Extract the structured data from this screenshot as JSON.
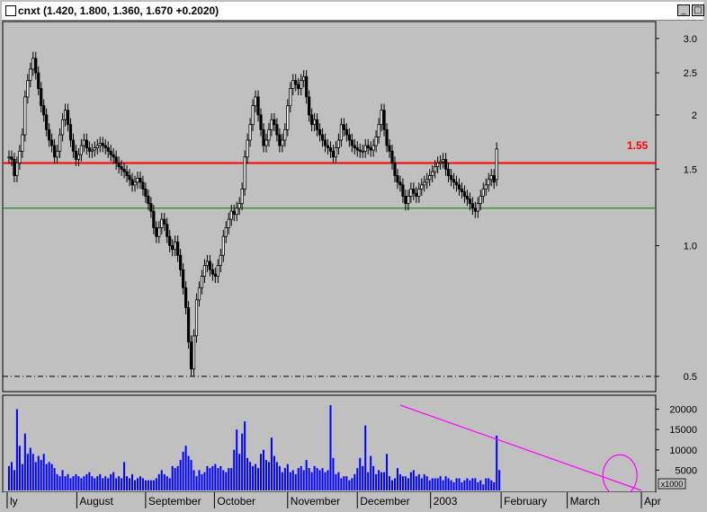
{
  "window": {
    "title": "cnxt  (1.420, 1.800, 1.360, 1.670 +0.2020)",
    "minimize_glyph": "_",
    "maximize_glyph": "□"
  },
  "colors": {
    "panel": "#c0c0c0",
    "candle": "#000000",
    "resistance": "#ff0000",
    "support": "#008000",
    "volume": "#0000ff",
    "trend": "#ff00ff",
    "annotation": "#ff0000"
  },
  "chart_data": [
    {
      "type": "line",
      "subtype": "candlestick",
      "scale": "log",
      "ylim": [
        0.47,
        3.25
      ],
      "yticks": [
        {
          "value": 3.0,
          "label": "3.0"
        },
        {
          "value": 2.5,
          "label": "2.5"
        },
        {
          "value": 2.0,
          "label": "2"
        },
        {
          "value": 1.5,
          "label": "1.5"
        },
        {
          "value": 1.0,
          "label": "1.0"
        },
        {
          "value": 0.5,
          "label": "0.5"
        }
      ],
      "series": [
        {
          "x": [
            0,
            3,
            6,
            9,
            12,
            15,
            18,
            21,
            24,
            27,
            30,
            33,
            36,
            39,
            42,
            45,
            48,
            51,
            54,
            57,
            60,
            63,
            66,
            69,
            72,
            75,
            78,
            81,
            84,
            87,
            90,
            93,
            96,
            99,
            102,
            105,
            108,
            111,
            114,
            117,
            120,
            123,
            126,
            129,
            132,
            135,
            138,
            141,
            144,
            147,
            150,
            153,
            156,
            159,
            162,
            165,
            168,
            171,
            174,
            177,
            180,
            183,
            186,
            189,
            192,
            195,
            198,
            201,
            204,
            207,
            210,
            213,
            216,
            219,
            222,
            225,
            228,
            231,
            234,
            237,
            240,
            243,
            246,
            249,
            252,
            255,
            258,
            261,
            264,
            267,
            270,
            273,
            276,
            279,
            282,
            285,
            288,
            291,
            294,
            297,
            300,
            303,
            306,
            309,
            312,
            315,
            318,
            321,
            324,
            327,
            330,
            333,
            336,
            339,
            342,
            345,
            348,
            351,
            354,
            357,
            360,
            363,
            366,
            369,
            372,
            375,
            378,
            381,
            384,
            387,
            390,
            393,
            396,
            399,
            402,
            405,
            408,
            411,
            414,
            417,
            420,
            423,
            426,
            429,
            432,
            435,
            438,
            441,
            444,
            447,
            450,
            453,
            456,
            459,
            462,
            465,
            468,
            471,
            474,
            477,
            480,
            483,
            486,
            489,
            492,
            495,
            498,
            501,
            504,
            507,
            510,
            513,
            516,
            519,
            522,
            525,
            528,
            531,
            534,
            537,
            540,
            543,
            546,
            549,
            552,
            555,
            558,
            561,
            564,
            567,
            570,
            573,
            576,
            579,
            582,
            585,
            588,
            591,
            594,
            597,
            600,
            603,
            606,
            609,
            612,
            615,
            618,
            621,
            624,
            627,
            630,
            633,
            636,
            639,
            642,
            645,
            648,
            651,
            654,
            657,
            660,
            663,
            666,
            669,
            672,
            675,
            678,
            681,
            684
          ],
          "close": [
            1.6,
            1.58,
            1.45,
            1.55,
            1.65,
            1.8,
            2.2,
            2.4,
            2.55,
            2.7,
            2.5,
            2.3,
            2.1,
            2.0,
            1.85,
            1.75,
            1.7,
            1.6,
            1.65,
            1.8,
            1.95,
            2.05,
            1.9,
            1.75,
            1.65,
            1.58,
            1.62,
            1.7,
            1.75,
            1.68,
            1.65,
            1.66,
            1.68,
            1.7,
            1.72,
            1.7,
            1.68,
            1.65,
            1.62,
            1.6,
            1.55,
            1.52,
            1.5,
            1.48,
            1.45,
            1.42,
            1.38,
            1.4,
            1.43,
            1.4,
            1.35,
            1.3,
            1.25,
            1.2,
            1.1,
            1.05,
            1.1,
            1.15,
            1.12,
            1.05,
            1.0,
            0.98,
            1.02,
            0.95,
            0.88,
            0.8,
            0.72,
            0.6,
            0.52,
            0.62,
            0.75,
            0.8,
            0.85,
            0.9,
            0.92,
            0.88,
            0.86,
            0.85,
            0.9,
            0.95,
            1.05,
            1.1,
            1.15,
            1.2,
            1.18,
            1.22,
            1.25,
            1.35,
            1.6,
            1.75,
            1.9,
            2.1,
            2.2,
            2.0,
            1.85,
            1.7,
            1.75,
            1.85,
            1.95,
            1.9,
            1.8,
            1.7,
            1.75,
            1.85,
            2.1,
            2.3,
            2.4,
            2.35,
            2.3,
            2.4,
            2.45,
            2.2,
            2.0,
            1.9,
            1.95,
            1.85,
            1.8,
            1.75,
            1.7,
            1.68,
            1.65,
            1.6,
            1.68,
            1.75,
            1.9,
            1.85,
            1.8,
            1.75,
            1.7,
            1.68,
            1.66,
            1.65,
            1.65,
            1.7,
            1.68,
            1.66,
            1.7,
            1.78,
            1.9,
            2.05,
            1.85,
            1.7,
            1.65,
            1.55,
            1.45,
            1.4,
            1.38,
            1.3,
            1.25,
            1.3,
            1.35,
            1.32,
            1.3,
            1.35,
            1.38,
            1.4,
            1.42,
            1.45,
            1.48,
            1.52,
            1.55,
            1.56,
            1.58,
            1.5,
            1.45,
            1.42,
            1.4,
            1.38,
            1.35,
            1.33,
            1.3,
            1.28,
            1.25,
            1.22,
            1.2,
            1.25,
            1.3,
            1.35,
            1.38,
            1.42,
            1.45,
            1.4,
            1.67
          ],
          "open": [
            1.6,
            1.6,
            1.58,
            1.45,
            1.55,
            1.65,
            1.8,
            2.2,
            2.4,
            2.55,
            2.7,
            2.5,
            2.3,
            2.1,
            2.0,
            1.85,
            1.75,
            1.7,
            1.6,
            1.65,
            1.8,
            1.95,
            2.05,
            1.9,
            1.75,
            1.65,
            1.58,
            1.62,
            1.7,
            1.75,
            1.68,
            1.65,
            1.66,
            1.68,
            1.7,
            1.72,
            1.7,
            1.68,
            1.65,
            1.62,
            1.6,
            1.55,
            1.52,
            1.5,
            1.48,
            1.45,
            1.42,
            1.38,
            1.4,
            1.43,
            1.4,
            1.35,
            1.3,
            1.25,
            1.2,
            1.1,
            1.05,
            1.1,
            1.15,
            1.12,
            1.05,
            1.0,
            0.98,
            1.02,
            0.95,
            0.88,
            0.8,
            0.72,
            0.6,
            0.52,
            0.62,
            0.75,
            0.8,
            0.85,
            0.9,
            0.92,
            0.88,
            0.86,
            0.85,
            0.9,
            0.95,
            1.05,
            1.1,
            1.15,
            1.2,
            1.18,
            1.22,
            1.25,
            1.35,
            1.6,
            1.75,
            1.9,
            2.1,
            2.2,
            2.0,
            1.85,
            1.7,
            1.75,
            1.85,
            1.95,
            1.9,
            1.8,
            1.7,
            1.75,
            1.85,
            2.1,
            2.3,
            2.4,
            2.35,
            2.3,
            2.4,
            2.45,
            2.2,
            2.0,
            1.9,
            1.95,
            1.85,
            1.8,
            1.75,
            1.7,
            1.68,
            1.65,
            1.6,
            1.68,
            1.75,
            1.9,
            1.85,
            1.8,
            1.75,
            1.7,
            1.68,
            1.66,
            1.65,
            1.65,
            1.7,
            1.68,
            1.66,
            1.7,
            1.78,
            1.9,
            2.05,
            1.85,
            1.7,
            1.65,
            1.55,
            1.45,
            1.4,
            1.38,
            1.3,
            1.25,
            1.3,
            1.35,
            1.32,
            1.3,
            1.35,
            1.38,
            1.4,
            1.42,
            1.45,
            1.48,
            1.52,
            1.55,
            1.56,
            1.58,
            1.5,
            1.45,
            1.42,
            1.4,
            1.38,
            1.35,
            1.33,
            1.3,
            1.28,
            1.25,
            1.22,
            1.2,
            1.25,
            1.3,
            1.35,
            1.38,
            1.42,
            1.45,
            1.42
          ]
        }
      ],
      "lines": [
        {
          "name": "resistance",
          "value": 1.55,
          "label": "1.55",
          "color": "#ff0000"
        },
        {
          "name": "support",
          "value": 1.22,
          "color": "#008000"
        },
        {
          "name": "low-level",
          "value": 0.5,
          "style": "dash-dot",
          "color": "#000000"
        }
      ],
      "annotations": [
        "1.55"
      ]
    },
    {
      "type": "bar",
      "ylim": [
        0,
        23000
      ],
      "ylabel": "x1000",
      "yticks": [
        {
          "value": 20000,
          "label": "20000"
        },
        {
          "value": 15000,
          "label": "15000"
        },
        {
          "value": 10000,
          "label": "10000"
        },
        {
          "value": 5000,
          "label": "5000"
        }
      ],
      "x": [
        0,
        3,
        6,
        9,
        12,
        15,
        18,
        21,
        24,
        27,
        30,
        33,
        36,
        39,
        42,
        45,
        48,
        51,
        54,
        57,
        60,
        63,
        66,
        69,
        72,
        75,
        78,
        81,
        84,
        87,
        90,
        93,
        96,
        99,
        102,
        105,
        108,
        111,
        114,
        117,
        120,
        123,
        126,
        129,
        132,
        135,
        138,
        141,
        144,
        147,
        150,
        153,
        156,
        159,
        162,
        165,
        168,
        171,
        174,
        177,
        180,
        183,
        186,
        189,
        192,
        195,
        198,
        201,
        204,
        207,
        210,
        213,
        216,
        219,
        222,
        225,
        228,
        231,
        234,
        237,
        240,
        243,
        246,
        249,
        252,
        255,
        258,
        261,
        264,
        267,
        270,
        273,
        276,
        279,
        282,
        285,
        288,
        291,
        294,
        297,
        300,
        303,
        306,
        309,
        312,
        315,
        318,
        321,
        324,
        327,
        330,
        333,
        336,
        339,
        342,
        345,
        348,
        351,
        354,
        357,
        360,
        363,
        366,
        369,
        372,
        375,
        378,
        381,
        384,
        387,
        390,
        393,
        396,
        399,
        402,
        405,
        408,
        411,
        414,
        417,
        420,
        423,
        426,
        429,
        432,
        435,
        438,
        441,
        444,
        447,
        450,
        453,
        456,
        459,
        462,
        465,
        468,
        471,
        474,
        477,
        480,
        483,
        486,
        489,
        492,
        495,
        498,
        501,
        504,
        507,
        510,
        513,
        516,
        519,
        522,
        525,
        528,
        531,
        534,
        537,
        540,
        543,
        546,
        549,
        552,
        555,
        558,
        561,
        564,
        567,
        570,
        573,
        576,
        579,
        582,
        585,
        588,
        591,
        594,
        597,
        600,
        603,
        606,
        609,
        612,
        615,
        618,
        621,
        624,
        627,
        630,
        633,
        636,
        639,
        642,
        645,
        648,
        651,
        654,
        657,
        660,
        663,
        666,
        669,
        672,
        675,
        678,
        681,
        684
      ],
      "values": [
        6000,
        7000,
        5000,
        20000,
        11000,
        6500,
        14000,
        9000,
        10500,
        9000,
        7000,
        8500,
        7500,
        9000,
        6500,
        7000,
        6500,
        5500,
        4000,
        3500,
        5000,
        3500,
        4000,
        3000,
        3500,
        4000,
        3500,
        3000,
        3500,
        4000,
        4500,
        3500,
        3000,
        3500,
        4000,
        3000,
        3500,
        3000,
        4000,
        4500,
        3000,
        3500,
        3000,
        7000,
        3500,
        3000,
        4000,
        2500,
        3000,
        3500,
        3000,
        2500,
        2500,
        2500,
        2500,
        3000,
        4000,
        5000,
        4000,
        3500,
        3000,
        6000,
        5500,
        6000,
        7500,
        9500,
        11000,
        8500,
        7500,
        5000,
        3500,
        5000,
        4000,
        4500,
        6000,
        5500,
        6000,
        6500,
        5500,
        6000,
        5000,
        4500,
        5500,
        5500,
        10000,
        15000,
        9000,
        14000,
        17000,
        8000,
        7000,
        6000,
        6500,
        5500,
        9000,
        10000,
        7500,
        7000,
        13000,
        8500,
        7000,
        6000,
        4500,
        5500,
        6500,
        4500,
        5000,
        4000,
        5500,
        6000,
        5000,
        7500,
        5500,
        4500,
        6000,
        5500,
        5000,
        5500,
        4500,
        5000,
        21000,
        8000,
        4000,
        4500,
        3000,
        3500,
        3500,
        2500,
        3000,
        4000,
        5500,
        8000,
        6000,
        16000,
        4500,
        8500,
        6000,
        4000,
        5000,
        4500,
        4500,
        9000,
        3500,
        2500,
        3000,
        5500,
        4000,
        3500,
        3500,
        3000,
        4500,
        5000,
        3500,
        4000,
        3000,
        4000,
        3500,
        2500,
        3000,
        3000,
        3000,
        3500,
        2500,
        3500,
        3000,
        2500,
        2000,
        3000,
        3000,
        2000,
        2500,
        3000,
        2500,
        3000,
        3000,
        2000,
        2500,
        1500,
        3000,
        3000,
        2500,
        2000,
        13500,
        5000
      ],
      "annotations": [
        "circle around final volume spike"
      ],
      "trendline": {
        "from": {
          "x": 438,
          "value": 21000
        },
        "to": {
          "x": 708,
          "value": 0
        },
        "color": "#ff00ff"
      }
    }
  ],
  "x_axis": {
    "range": [
      -5,
      718
    ],
    "labels": [
      {
        "x": 0,
        "label": "ly"
      },
      {
        "x": 78,
        "label": "August"
      },
      {
        "x": 155,
        "label": "September"
      },
      {
        "x": 232,
        "label": "October"
      },
      {
        "x": 314,
        "label": "November"
      },
      {
        "x": 392,
        "label": "December"
      },
      {
        "x": 474,
        "label": "2003"
      },
      {
        "x": 553,
        "label": "February"
      },
      {
        "x": 627,
        "label": "March"
      },
      {
        "x": 710,
        "label": "Apr"
      }
    ]
  }
}
